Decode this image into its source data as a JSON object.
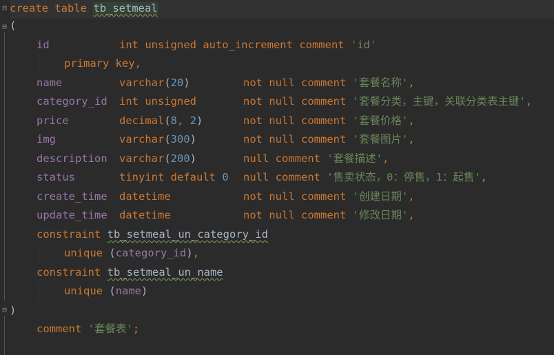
{
  "editor": {
    "lines": {
      "l0": {
        "kw_create": "create",
        "kw_table": "table",
        "table_name": "tb_setmeal"
      },
      "l1": {
        "open_paren": "("
      },
      "l2": {
        "col": "id",
        "type": "int unsigned auto_increment",
        "kw_comment": "comment",
        "comment": "'id'"
      },
      "l3": {
        "kw": "primary key,"
      },
      "l4": {
        "col": "name",
        "type": "varchar",
        "lp": "(",
        "num": "20",
        "rp": ")",
        "constraint": "not null",
        "kw_comment": "comment",
        "comment": "'套餐名称'",
        "end": ","
      },
      "l5": {
        "col": "category_id",
        "type": "int unsigned",
        "constraint": "not null",
        "kw_comment": "comment",
        "comment": "'套餐分类，主键，关联分类表主键'",
        "end": ","
      },
      "l6": {
        "col": "price",
        "type": "decimal",
        "lp": "(",
        "num1": "8",
        "sep": ", ",
        "num2": "2",
        "rp": ")",
        "constraint": "not null",
        "kw_comment": "comment",
        "comment": "'套餐价格'",
        "end": ","
      },
      "l7": {
        "col": "img",
        "type": "varchar",
        "lp": "(",
        "num": "300",
        "rp": ")",
        "constraint": "not null",
        "kw_comment": "comment",
        "comment": "'套餐图片'",
        "end": ","
      },
      "l8": {
        "col": "description",
        "type": "varchar",
        "lp": "(",
        "num": "200",
        "rp": ")",
        "constraint": "null",
        "kw_comment": "comment",
        "comment": "'套餐描述'",
        "end": ","
      },
      "l9": {
        "col": "status",
        "type": "tinyint default",
        "num": "0",
        "constraint": "null",
        "kw_comment": "comment",
        "comment": "'售卖状态，0：停售，1：起售'",
        "end": ","
      },
      "l10": {
        "col": "create_time",
        "type": "datetime",
        "constraint": "not null",
        "kw_comment": "comment",
        "comment": "'创建日期'",
        "end": ","
      },
      "l11": {
        "col": "update_time",
        "type": "datetime",
        "constraint": "not null",
        "kw_comment": "comment",
        "comment": "'修改日期'",
        "end": ","
      },
      "l12": {
        "kw": "constraint",
        "name": "tb_setmeal_un_category_id"
      },
      "l13": {
        "kw": "unique",
        "lp": "(",
        "col": "category_id",
        "rp": ")",
        "end": ","
      },
      "l14": {
        "kw": "constraint",
        "name": "tb_setmeal_un_name"
      },
      "l15": {
        "kw": "unique",
        "lp": "(",
        "col": "name",
        "rp": ")"
      },
      "l16": {
        "close_paren": ")"
      },
      "l17": {
        "kw_comment": "comment",
        "comment": "'套餐表'",
        "end": ";"
      }
    }
  },
  "colors": {
    "background": "#2b2b2b",
    "keyword": "#cc7832",
    "identifier": "#9876aa",
    "string": "#6a8759",
    "number": "#6897bb",
    "text": "#a9b7c6"
  },
  "icons": {
    "fold_open": "fold-open-icon",
    "fold_close": "fold-close-icon"
  }
}
